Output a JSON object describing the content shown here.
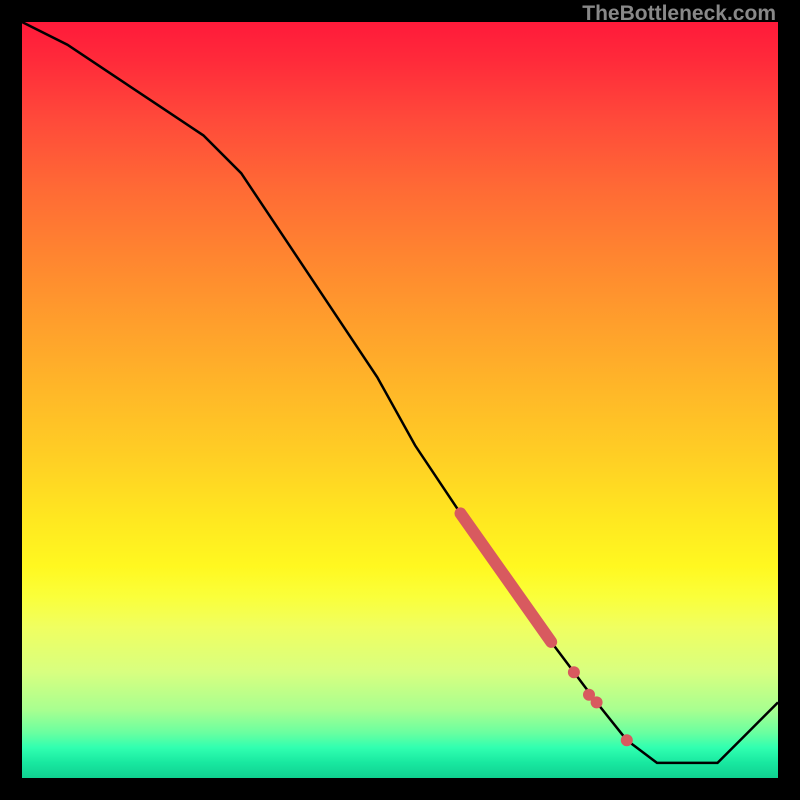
{
  "watermark": "TheBottleneck.com",
  "colors": {
    "line": "#000000",
    "marker": "#d85a5f",
    "frame": "#000000"
  },
  "chart_data": {
    "type": "line",
    "title": "",
    "xlabel": "",
    "ylabel": "",
    "xlim": [
      0,
      100
    ],
    "ylim": [
      0,
      100
    ],
    "grid": false,
    "legend": false,
    "note": "Axes are unlabeled in source image; values are proportional estimates from pixel positions (origin bottom-left).",
    "series": [
      {
        "name": "bottleneck-curve",
        "x": [
          0,
          6,
          12,
          18,
          24,
          29,
          35,
          41,
          47,
          52,
          58,
          64,
          70,
          76,
          80,
          84,
          88,
          92,
          96,
          100
        ],
        "y": [
          100,
          97,
          93,
          89,
          85,
          80,
          71,
          62,
          53,
          44,
          35,
          27,
          18,
          10,
          5,
          2,
          2,
          2,
          6,
          10
        ]
      }
    ],
    "markers": [
      {
        "name": "highlight-segment",
        "shape": "thick-line",
        "color": "#d85a5f",
        "x": [
          58,
          70
        ],
        "y": [
          35,
          18
        ]
      },
      {
        "name": "highlight-dots",
        "shape": "circle",
        "color": "#d85a5f",
        "points": [
          {
            "x": 73,
            "y": 14
          },
          {
            "x": 75,
            "y": 11
          },
          {
            "x": 76,
            "y": 10
          },
          {
            "x": 80,
            "y": 5
          }
        ]
      }
    ],
    "background": {
      "type": "vertical-gradient",
      "stops": [
        {
          "pos": 0.0,
          "color": "#ff1a3a"
        },
        {
          "pos": 0.5,
          "color": "#ffd024"
        },
        {
          "pos": 0.78,
          "color": "#faff3a"
        },
        {
          "pos": 1.0,
          "color": "#10d090"
        }
      ]
    }
  }
}
